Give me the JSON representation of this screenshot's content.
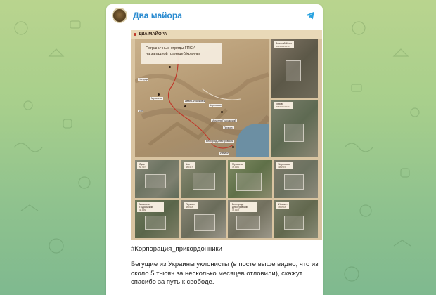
{
  "channel": {
    "name": "Два майора",
    "avatar_icon": "channel-avatar-icon",
    "action_icon": "telegram-share-icon",
    "accent_color": "#2a8bd0"
  },
  "media": {
    "brand": "ДВА МАЙОРА",
    "map_title_line1": "Пограничные отряды ГПСУ",
    "map_title_line2": "на западной границе Украины",
    "map_labels": [
      "Ужгород",
      "Мукачево",
      "Чоп",
      "Ивано-Франковск",
      "Черновцы",
      "Измаил",
      "Белгород-Днестровский",
      "Могилев-Подольский",
      "Перволз"
    ],
    "thumbnails": [
      {
        "title": "Великий Мост",
        "coords": "50.2404 24.1333"
      },
      {
        "title": "Львов",
        "coords": "49.8334 24.0211"
      },
      {
        "title": "Луцк",
        "coords": "50.7472"
      },
      {
        "title": "Чоп",
        "coords": "48.4317"
      },
      {
        "title": "Мукачево",
        "coords": "48.4491"
      },
      {
        "title": "Черновцы",
        "coords": "48.2915"
      },
      {
        "title": "Могилев-Подольский",
        "coords": "48.4468"
      },
      {
        "title": "Перволз",
        "coords": "48.0318"
      },
      {
        "title": "Белгород-Днестровский",
        "coords": "46.1936"
      },
      {
        "title": "Измаил",
        "coords": "45.3518"
      }
    ]
  },
  "post": {
    "hashtag": "#Корпорация_прикордонники",
    "text": "Бегущие из Украины уклонисты (в посте выше видно, что из около 5 тысяч за несколько месяцев отловили), скажут спасибо за путь к свободе."
  }
}
